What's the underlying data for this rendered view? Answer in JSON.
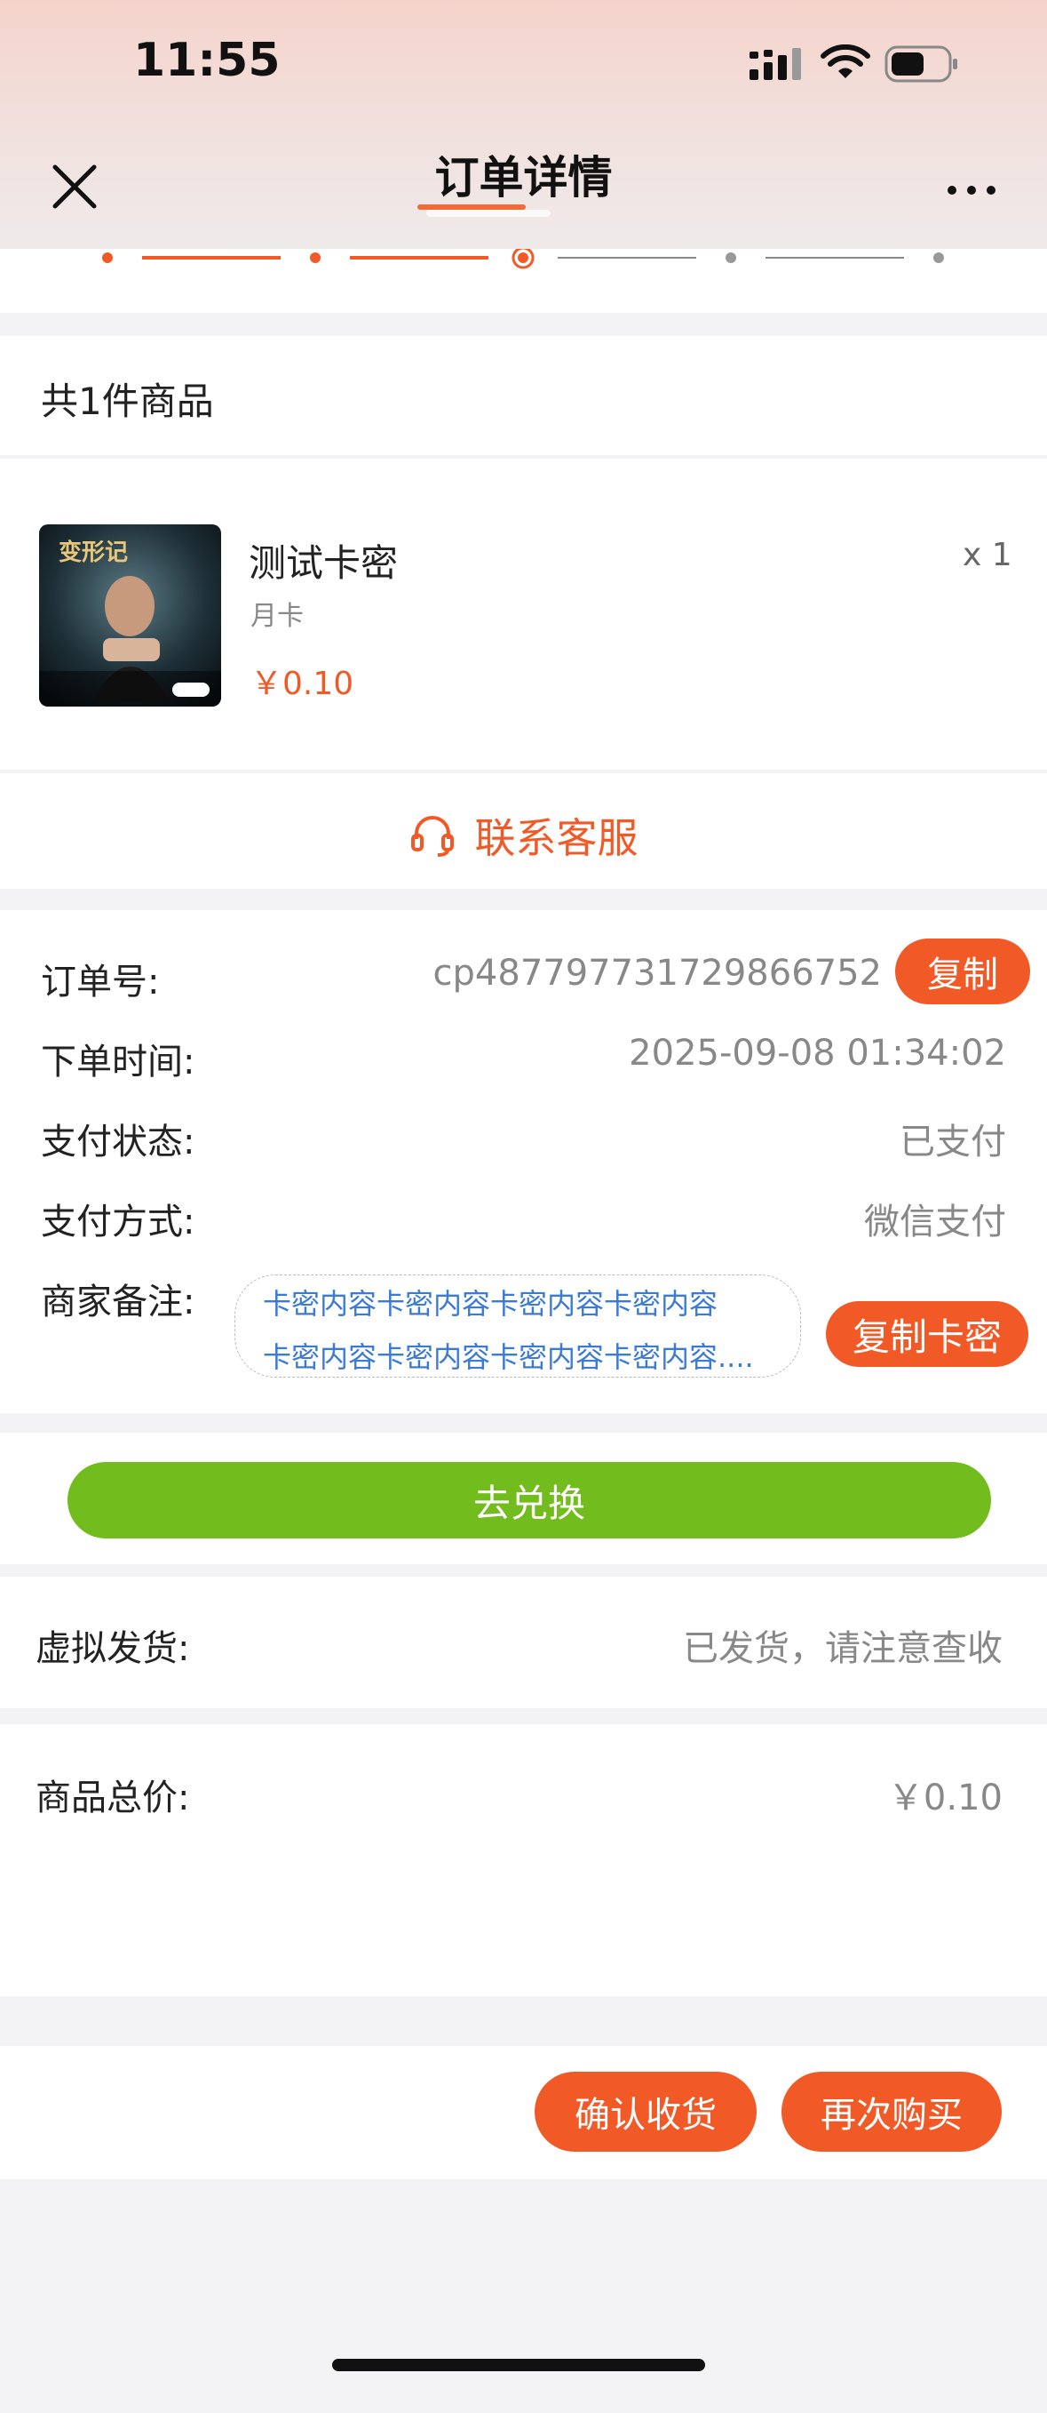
{
  "status_bar": {
    "time": "11:55"
  },
  "nav": {
    "title": "订单详情"
  },
  "order": {
    "item_count_label": "共1件商品",
    "product": {
      "name": "测试卡密",
      "spec": "月卡",
      "price": "￥0.10",
      "quantity": "x 1"
    },
    "customer_service_label": "联系客服"
  },
  "info": {
    "order_no_label": "订单号:",
    "order_no_value": "cp487797731729866752",
    "copy_label": "复制",
    "order_time_label": "下单时间:",
    "order_time_value": "2025-09-08 01:34:02",
    "pay_status_label": "支付状态:",
    "pay_status_value": "已支付",
    "pay_method_label": "支付方式:",
    "pay_method_value": "微信支付",
    "merchant_note_label": "商家备注:",
    "merchant_note_line1": "卡密内容卡密内容卡密内容卡密内容",
    "merchant_note_line2": "卡密内容卡密内容卡密内容卡密内容....",
    "copy_card_label": "复制卡密"
  },
  "redeem": {
    "label": "去兑换"
  },
  "shipping": {
    "label": "虚拟发货:",
    "value": "已发货，请注意查收"
  },
  "total": {
    "label": "商品总价:",
    "value": "￥0.10"
  },
  "actions": {
    "confirm_label": "确认收货",
    "rebuy_label": "再次购买"
  },
  "colors": {
    "accent": "#f15a27",
    "redeem_green": "#72bd1d",
    "note_blue": "#3a7bd5"
  }
}
